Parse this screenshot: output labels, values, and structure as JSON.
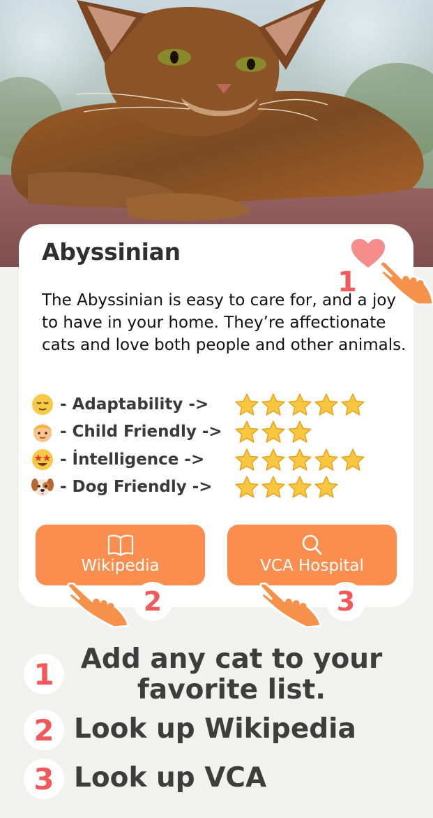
{
  "hero": {
    "image_alt": "Abyssinian cat lying on a stone wall"
  },
  "card": {
    "breed_name": "Abyssinian",
    "favorite_icon": "heart-icon",
    "description": "The Abyssinian is easy to care for, and a joy to have in your home. They’re affectionate cats and love both people and other animals.",
    "traits": [
      {
        "icon": "relieved-face-icon",
        "label": "- Adaptability ->",
        "rating": 5
      },
      {
        "icon": "child-face-icon",
        "label": "- Child Friendly ->",
        "rating": 3
      },
      {
        "icon": "star-struck-face-icon",
        "label": "- İntelligence ->",
        "rating": 5
      },
      {
        "icon": "dog-face-icon",
        "label": "- Dog Friendly ->",
        "rating": 4
      }
    ],
    "buttons": {
      "wikipedia": {
        "label": "Wikipedia",
        "icon": "book-icon"
      },
      "vca": {
        "label": "VCA Hospital",
        "icon": "search-icon"
      }
    }
  },
  "annotations": {
    "heart_number": "1",
    "wiki_number": "2",
    "vca_number": "3"
  },
  "legend": [
    {
      "number": "1",
      "text_line1": "Add any cat to your",
      "text_line2": "favorite list."
    },
    {
      "number": "2",
      "text_line1": "Look up Wikipedia"
    },
    {
      "number": "3",
      "text_line1": "Look up VCA"
    }
  ],
  "colors": {
    "accent_orange": "#fb8d4e",
    "badge_red": "#f15a5a",
    "heart_pink": "#f48c8c",
    "background": "#f1f1f0"
  }
}
